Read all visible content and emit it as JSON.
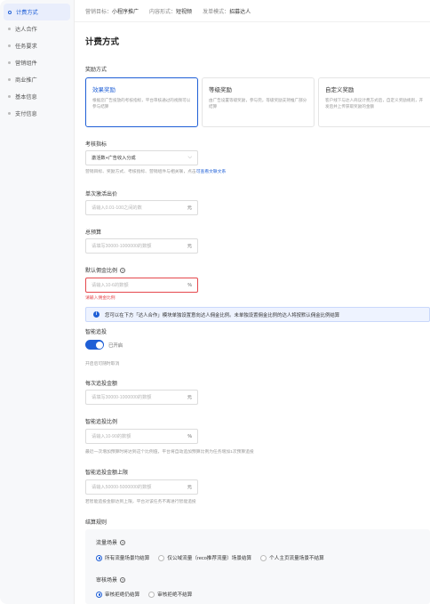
{
  "sidebar": {
    "items": [
      {
        "label": "计费方式",
        "active": true
      },
      {
        "label": "达人合作"
      },
      {
        "label": "任务要求"
      },
      {
        "label": "营销组件"
      },
      {
        "label": "商业推广"
      },
      {
        "label": "基本信息"
      },
      {
        "label": "支付信息"
      }
    ]
  },
  "topbar": {
    "goal_key": "营销目标：",
    "goal_val": "小程序推广",
    "form_key": "内容形式：",
    "form_val": "短视频",
    "mode_key": "发单模式：",
    "mode_val": "招募达人"
  },
  "page_title": "计费方式",
  "reward": {
    "label": "奖励方式",
    "cards": [
      {
        "title": "效果奖励",
        "desc": "根据您广告投放的考核指标，平台审核通过的视频可以参与结算",
        "selected": true
      },
      {
        "title": "等级奖励",
        "desc": "由广告设置等级奖励，参与完，等级奖励支持推广部分结算"
      },
      {
        "title": "自定义奖励",
        "desc": "客户线下与达人商议计费方式后，自定义奖励规则，开发后并上传获取奖励的金额"
      }
    ]
  },
  "metric": {
    "label": "考核指标",
    "value": "激活数+广告收入分成",
    "hint": "营销目标、奖励方式、考核指标、营销组件与相关联，点击",
    "hint_link": "可查看文联文系"
  },
  "cpa": {
    "label": "单次激活出价",
    "placeholder": "请输入0.01-100之间的数",
    "suffix": "元"
  },
  "budget": {
    "label": "总预算",
    "placeholder": "请填写30000-1000000的数额",
    "suffix": "元"
  },
  "commission": {
    "label": "默认佣金比例",
    "placeholder": "请输入10-6的数额",
    "suffix": "%",
    "error": "请输入佣金比例"
  },
  "banner": {
    "text": "您可以在下方「达人合作」模块单独设置意向达人佣金比例。未单独设置佣金比例的达人将按默认佣金比例结算"
  },
  "smart_boost": {
    "label": "智能追投",
    "toggle_text": "已开启",
    "hint": "开启后可随时取消"
  },
  "boost_amount": {
    "label": "每次追投金额",
    "placeholder": "请填写30000-1000000的数额",
    "suffix": "元"
  },
  "boost_ratio": {
    "label": "智能追投比例",
    "placeholder": "请输入10-90的数额",
    "suffix": "%",
    "hint": "最近一次增加预算时将达到这个比例值，平台将自动追加预算比例为任务增加1次预算追投"
  },
  "boost_cap": {
    "label": "智能追投金额上限",
    "placeholder": "请输入50000-5000000的数额",
    "suffix": "元",
    "hint": "若智能追投金额达到上限，平台对该任务不再进行智能追投"
  },
  "settlement": {
    "label": "结算规则",
    "traffic": {
      "label": "流量场景",
      "options": [
        {
          "text": "所有流量场景均结算",
          "checked": true
        },
        {
          "text": "仅公域流量（reco推荐流量）场景结算"
        },
        {
          "text": "个人主页流量场景不结算"
        }
      ]
    },
    "review": {
      "label": "审核场景",
      "options": [
        {
          "text": "审核拒绝仍结算",
          "checked": true
        },
        {
          "text": "审核拒绝不结算"
        }
      ]
    }
  },
  "colors": {
    "primary": "#1f5fd6",
    "error": "#e5484d"
  }
}
